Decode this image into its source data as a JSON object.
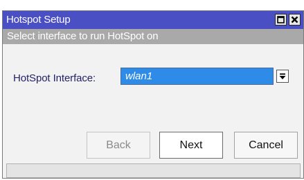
{
  "window": {
    "title": "Hotspot Setup"
  },
  "subtitle": "Select interface to run HotSpot on",
  "form": {
    "label": "HotSpot Interface:",
    "interface_value": "wlan1"
  },
  "buttons": {
    "back": "Back",
    "next": "Next",
    "cancel": "Cancel"
  },
  "status": "",
  "colors": {
    "titlebar": "#4a4fc4",
    "subtitle": "#a9a9a9",
    "selection": "#2f8be8"
  },
  "icons": {
    "maximize": "maximize-icon",
    "close": "close-icon",
    "dropdown": "dropdown-arrow-icon"
  }
}
